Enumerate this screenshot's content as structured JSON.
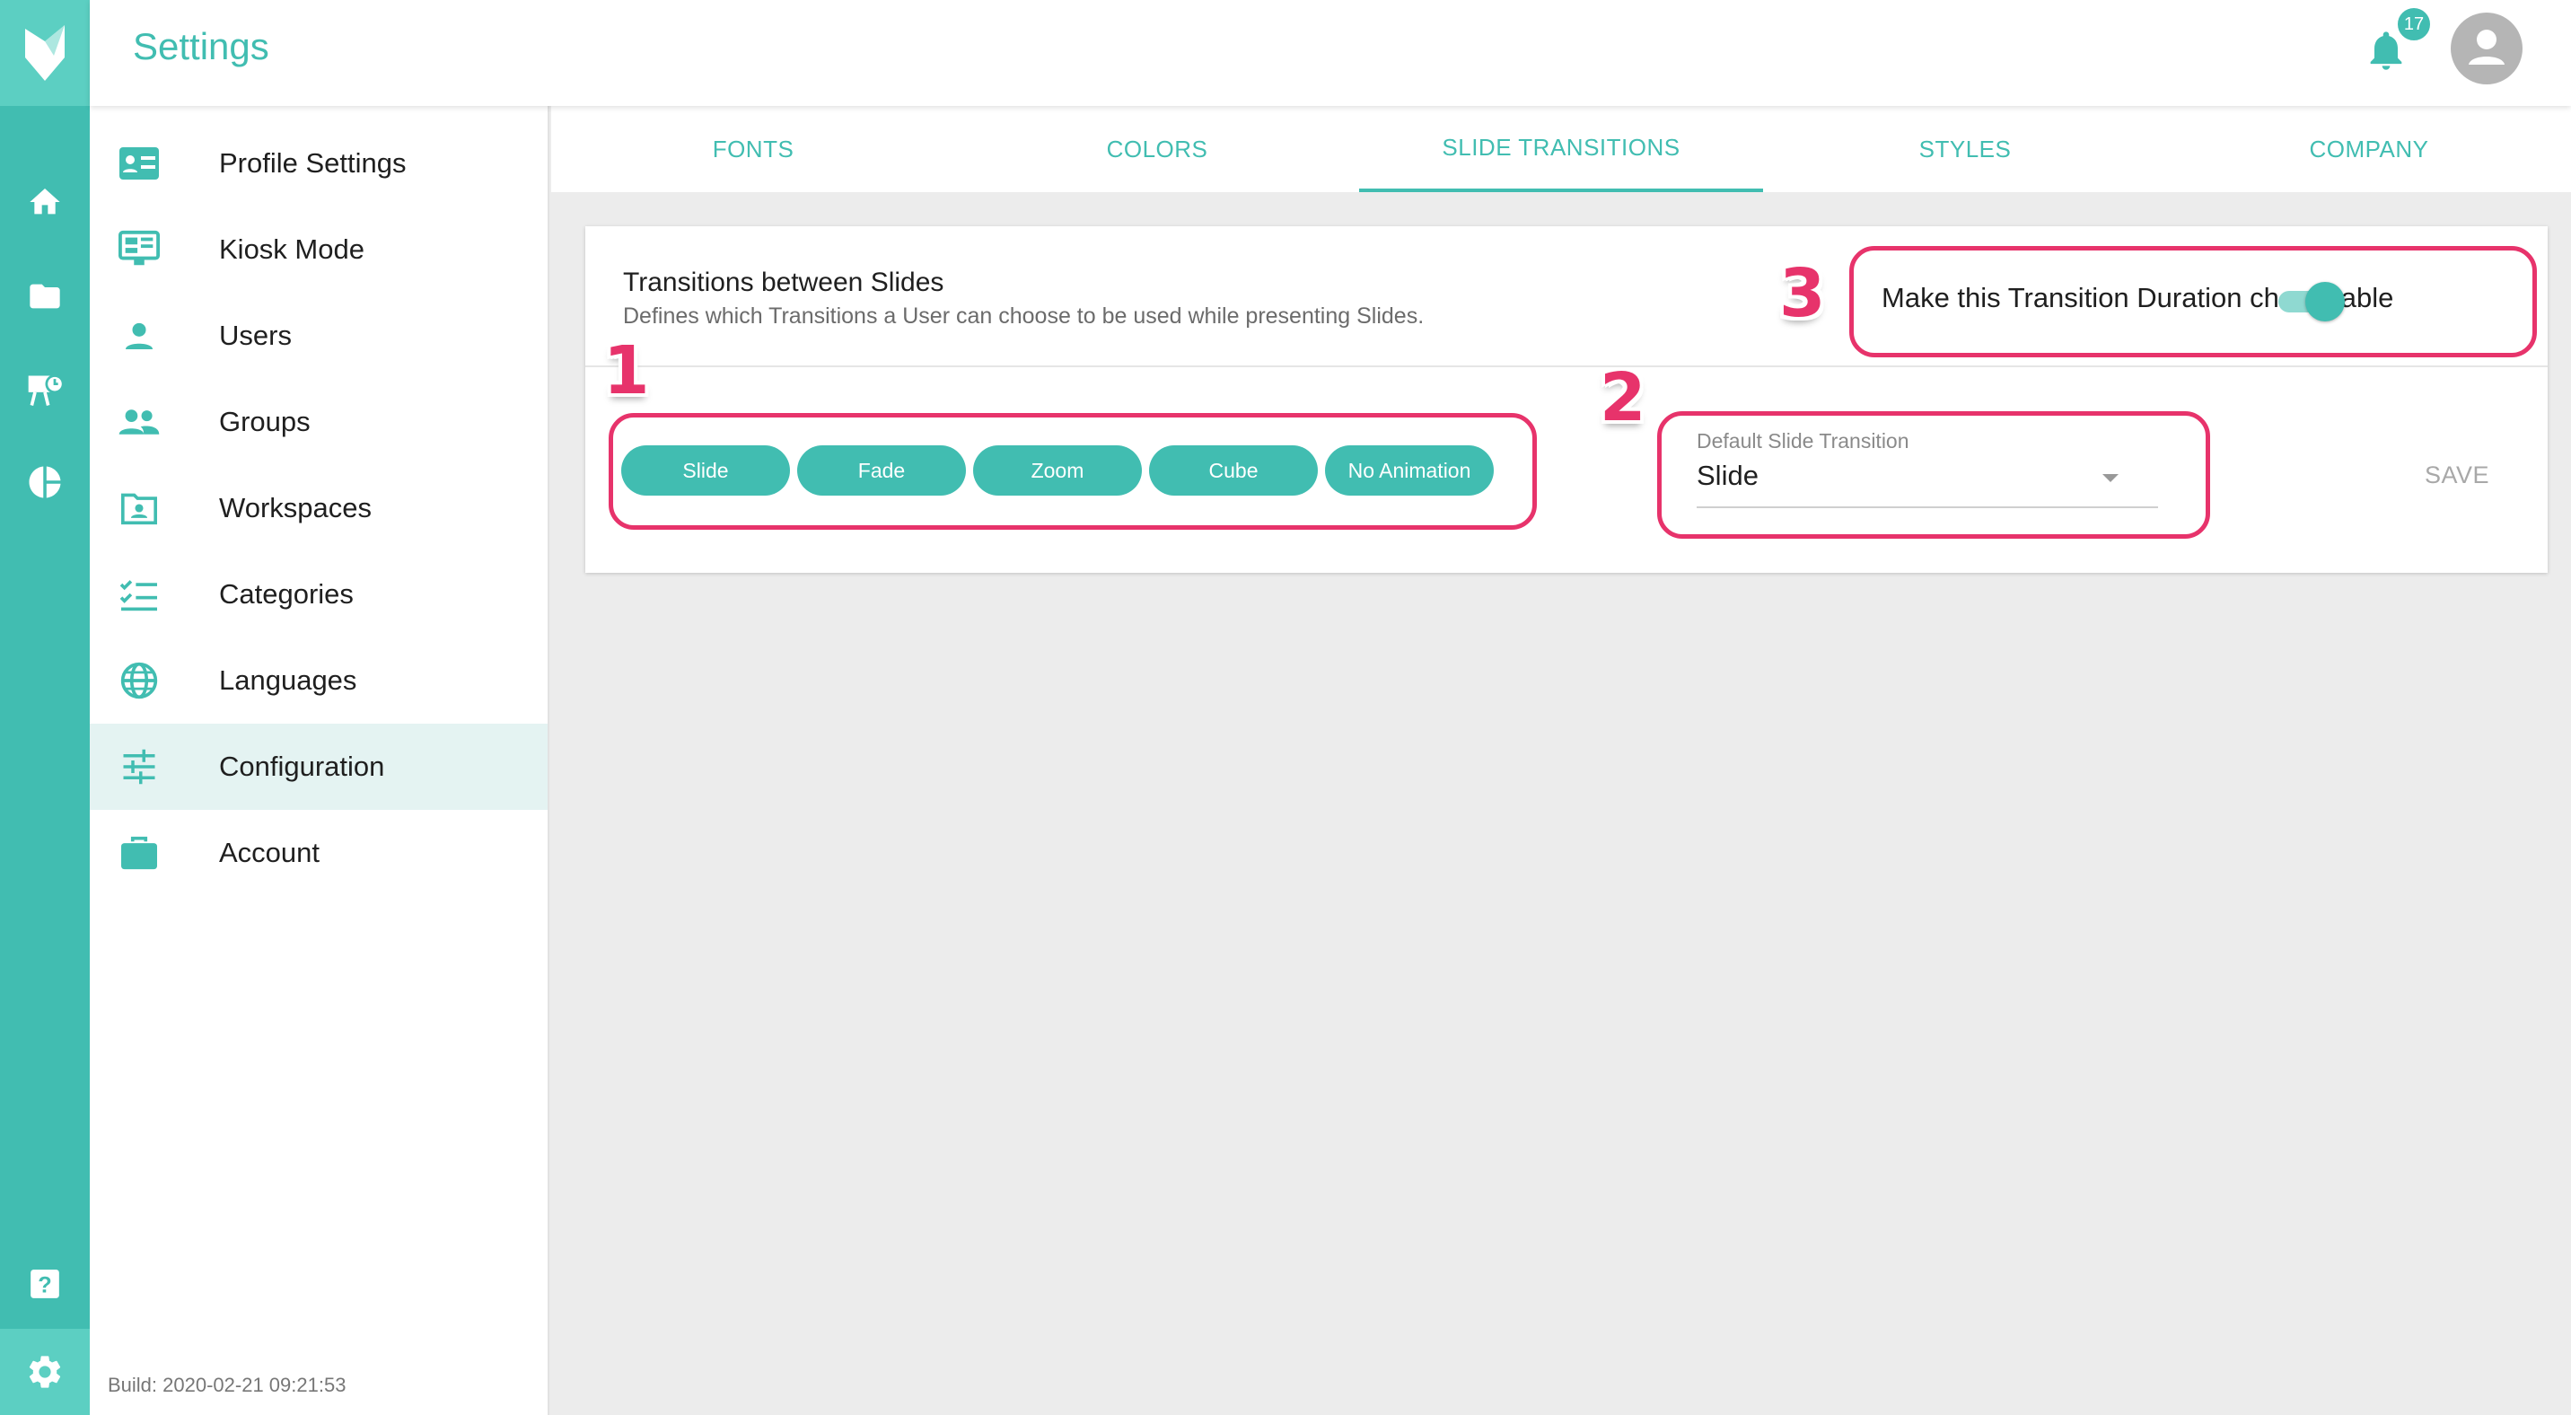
{
  "app": {
    "title": "Settings",
    "notification_count": "17",
    "build": "Build: 2020-02-21 09:21:53"
  },
  "rail": {
    "icons": [
      "logo-icon",
      "home-icon",
      "folder-icon",
      "presentation-icon",
      "pie-chart-icon",
      "help-icon",
      "gear-icon"
    ]
  },
  "sidebar": {
    "items": [
      {
        "label": "Profile Settings",
        "icon": "id-card-icon"
      },
      {
        "label": "Kiosk Mode",
        "icon": "monitor-icon"
      },
      {
        "label": "Users",
        "icon": "user-icon"
      },
      {
        "label": "Groups",
        "icon": "group-icon"
      },
      {
        "label": "Workspaces",
        "icon": "workspace-folder-icon"
      },
      {
        "label": "Categories",
        "icon": "checklist-icon"
      },
      {
        "label": "Languages",
        "icon": "globe-icon"
      },
      {
        "label": "Configuration",
        "icon": "sliders-icon",
        "active": true
      },
      {
        "label": "Account",
        "icon": "briefcase-icon"
      }
    ]
  },
  "tabs": [
    {
      "label": "FONTS"
    },
    {
      "label": "COLORS"
    },
    {
      "label": "SLIDE TRANSITIONS",
      "active": true
    },
    {
      "label": "STYLES"
    },
    {
      "label": "COMPANY"
    }
  ],
  "card": {
    "title": "Transitions between Slides",
    "subtitle": "Defines which Transitions a User can choose to be used while presenting Slides.",
    "toggle_label": "Make this Transition Duration changeable",
    "toggle_on": true,
    "chips": [
      "Slide",
      "Fade",
      "Zoom",
      "Cube",
      "No Animation"
    ],
    "select_label": "Default Slide Transition",
    "select_value": "Slide",
    "save_label": "SAVE"
  },
  "annotations": [
    "1",
    "2",
    "3"
  ],
  "colors": {
    "accent": "#41bdb1",
    "accent_light": "#5ccfc2",
    "highlight": "#e7336b",
    "active_bg": "#e4f3f2"
  }
}
